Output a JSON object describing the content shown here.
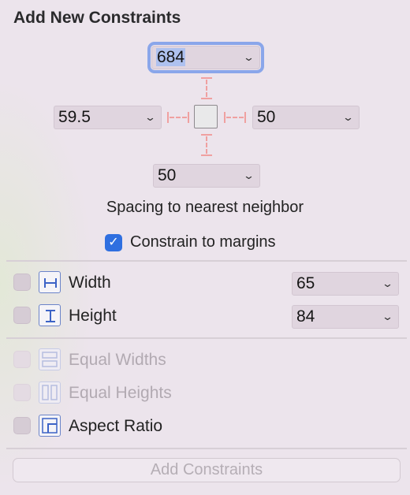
{
  "panel": {
    "title": "Add New Constraints"
  },
  "spacing": {
    "top": "684",
    "left": "59.5",
    "right": "50",
    "bottom": "50",
    "caption": "Spacing to nearest neighbor"
  },
  "constrain_to_margins": {
    "label": "Constrain to margins",
    "checked": true
  },
  "size_rows": [
    {
      "label": "Width",
      "value": "65",
      "checked": false,
      "icon": "width-icon"
    },
    {
      "label": "Height",
      "value": "84",
      "checked": false,
      "icon": "height-icon"
    }
  ],
  "equal_rows": [
    {
      "label": "Equal Widths",
      "enabled": false,
      "icon": "equal-widths-icon"
    },
    {
      "label": "Equal Heights",
      "enabled": false,
      "icon": "equal-heights-icon"
    },
    {
      "label": "Aspect Ratio",
      "enabled": true,
      "icon": "aspect-ratio-icon"
    }
  ],
  "add_button": {
    "label": "Add Constraints",
    "enabled": false
  },
  "colors": {
    "accent": "#2f6fe0",
    "focus_ring": "#8aa6ea",
    "strut": "#f0a0a0"
  }
}
